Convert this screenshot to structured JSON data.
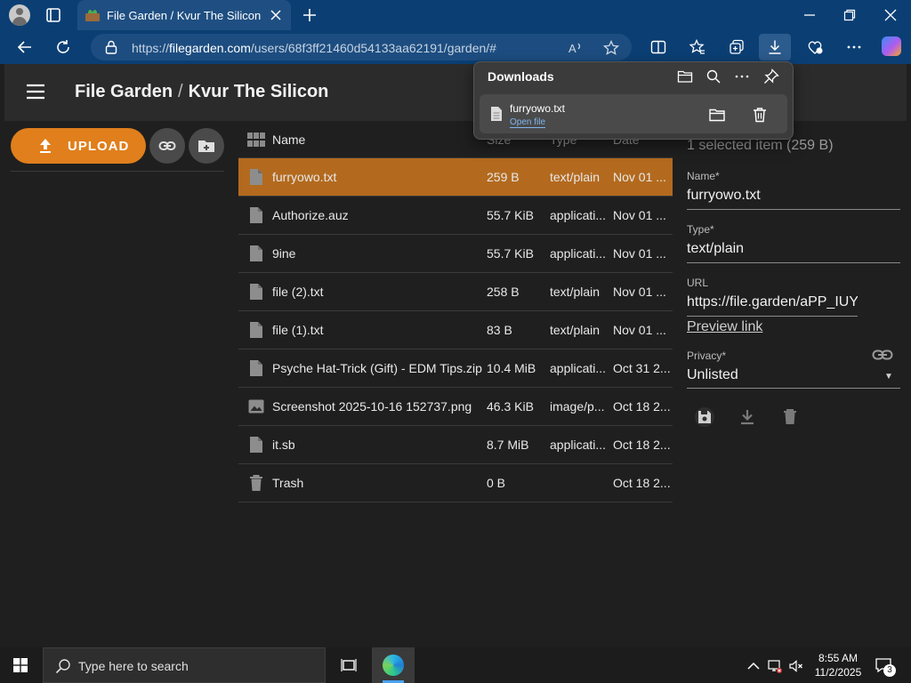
{
  "browser": {
    "tab_title": "File Garden / Kvur The Silicon",
    "url_prefix": "https://",
    "url_domain": "filegarden.com",
    "url_path": "/users/68f3ff21460d54133aa62191/garden/#"
  },
  "downloads": {
    "title": "Downloads",
    "item_name": "furryowo.txt",
    "open_link": "Open file"
  },
  "app": {
    "title": "File Garden",
    "separator": "/",
    "user": "Kvur The Silicon",
    "upload_label": "UPLOAD"
  },
  "list": {
    "header_name": "Name",
    "header_size": "Size",
    "header_type": "Type",
    "header_date": "Date",
    "rows": [
      {
        "name": "furryowo.txt",
        "size": "259 B",
        "type": "text/plain",
        "date": "Nov 01 ...",
        "icon": "file-icon"
      },
      {
        "name": "Authorize.auz",
        "size": "55.7 KiB",
        "type": "applicati...",
        "date": "Nov 01 ...",
        "icon": "file-icon"
      },
      {
        "name": "9ine",
        "size": "55.7 KiB",
        "type": "applicati...",
        "date": "Nov 01 ...",
        "icon": "file-icon"
      },
      {
        "name": "file (2).txt",
        "size": "258 B",
        "type": "text/plain",
        "date": "Nov 01 ...",
        "icon": "file-icon"
      },
      {
        "name": "file (1).txt",
        "size": "83 B",
        "type": "text/plain",
        "date": "Nov 01 ...",
        "icon": "file-icon"
      },
      {
        "name": "Psyche Hat-Trick (Gift) - EDM Tips.zip",
        "size": "10.4 MiB",
        "type": "applicati...",
        "date": "Oct 31 2...",
        "icon": "file-icon"
      },
      {
        "name": "Screenshot 2025-10-16 152737.png",
        "size": "46.3 KiB",
        "type": "image/p...",
        "date": "Oct 18 2...",
        "icon": "image-icon"
      },
      {
        "name": "it.sb",
        "size": "8.7 MiB",
        "type": "applicati...",
        "date": "Oct 18 2...",
        "icon": "file-icon"
      },
      {
        "name": "Trash",
        "size": "0 B",
        "type": "",
        "date": "Oct 18 2...",
        "icon": "trash-icon"
      }
    ]
  },
  "details": {
    "selection": "1 selected item (259 B)",
    "name_label": "Name*",
    "name_value": "furryowo.txt",
    "type_label": "Type*",
    "type_value": "text/plain",
    "url_label": "URL",
    "url_value": "https://file.garden/aPP_IUY",
    "preview_link": "Preview link",
    "privacy_label": "Privacy*",
    "privacy_value": "Unlisted"
  },
  "taskbar": {
    "search_placeholder": "Type here to search",
    "time": "8:55 AM",
    "date": "11/2/2025",
    "notification_count": "3"
  },
  "colors": {
    "accent": "#e07f1c",
    "selected_row": "#b36a1e",
    "browser_chrome": "#0b3f74",
    "app_bar": "#2b2b2b",
    "page_bg": "#1f1f1f"
  }
}
